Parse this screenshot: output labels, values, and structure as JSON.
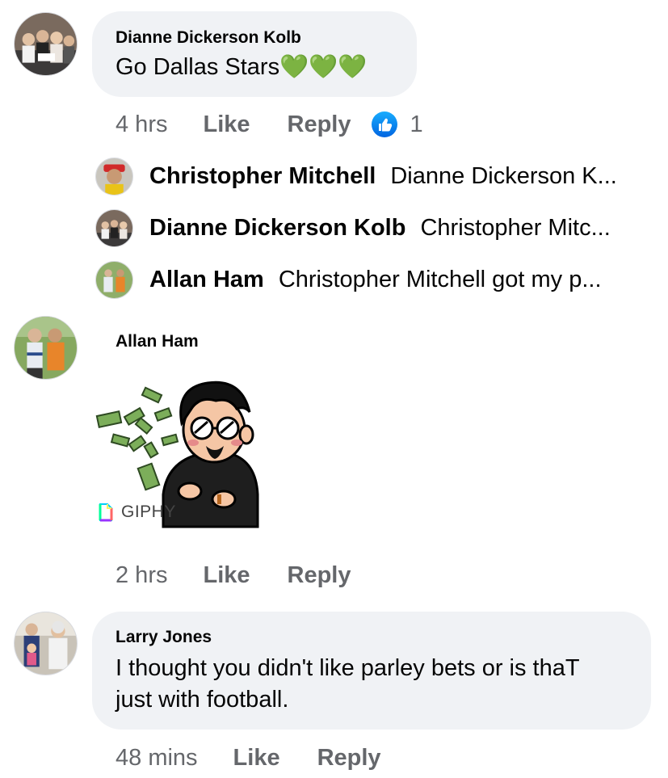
{
  "comments": [
    {
      "author": "Dianne Dickerson Kolb",
      "text": "Go Dallas Stars💚💚💚",
      "time": "4 hrs",
      "like_label": "Like",
      "reply_label": "Reply",
      "reaction_count": "1",
      "replies": [
        {
          "author": "Christopher Mitchell",
          "text": "Dianne Dickerson K..."
        },
        {
          "author": "Dianne Dickerson Kolb",
          "text": "Christopher Mitc..."
        },
        {
          "author": "Allan Ham",
          "text": "Christopher Mitchell got my p..."
        }
      ]
    },
    {
      "author": "Allan Ham",
      "gif_source": "GIPHY",
      "time": "2 hrs",
      "like_label": "Like",
      "reply_label": "Reply"
    },
    {
      "author": "Larry Jones",
      "text_line1": "I thought you didn't like parley bets or is thaT",
      "text_line2": "just with football.",
      "time": "48 mins",
      "like_label": "Like",
      "reply_label": "Reply"
    }
  ],
  "colors": {
    "bubble": "#f0f2f5",
    "meta_text": "#65676b",
    "like_reaction": "#1877f2"
  }
}
